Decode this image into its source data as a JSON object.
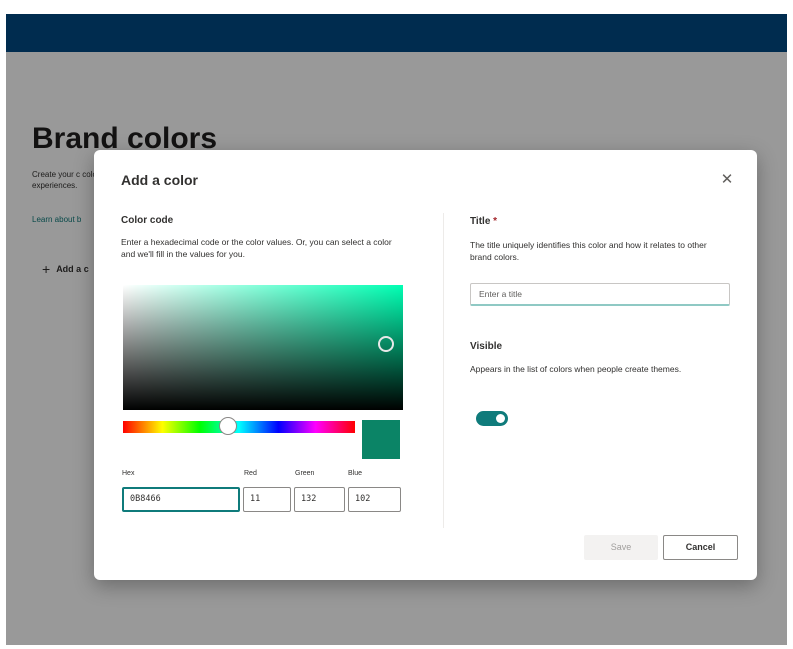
{
  "colors": {
    "suitebar": "#004A84",
    "accent": "#0F7B7B",
    "selected_color": "#0B8466"
  },
  "page": {
    "title": "Brand colors",
    "description": "Create your custom colors. These colors can be used to create experiences.",
    "description_visible": "Create your c colors can be experiences.",
    "learn_link": "Learn about b",
    "add_color_label": "Add a c",
    "add_icon": "+"
  },
  "dialog": {
    "title": "Add a color",
    "close_icon": "✕",
    "color_code": {
      "label": "Color code",
      "description": "Enter a hexadecimal code or the color values. Or, you can select a color and we'll fill in the values for you."
    },
    "picker": {
      "hue_degrees": 165,
      "saturation": 0.92,
      "value": 0.52
    },
    "fields": {
      "hex_label": "Hex",
      "hex_value": "0B8466",
      "red_label": "Red",
      "red_value": "11",
      "green_label": "Green",
      "green_value": "132",
      "blue_label": "Blue",
      "blue_value": "102"
    },
    "title_field": {
      "label": "Title",
      "required_mark": "*",
      "description": "The title uniquely identifies this color and how it relates to other brand colors.",
      "placeholder": "Enter a title",
      "value": ""
    },
    "visible": {
      "label": "Visible",
      "description": "Appears in the list of colors when people create themes.",
      "on": true
    },
    "buttons": {
      "save": "Save",
      "cancel": "Cancel"
    }
  }
}
